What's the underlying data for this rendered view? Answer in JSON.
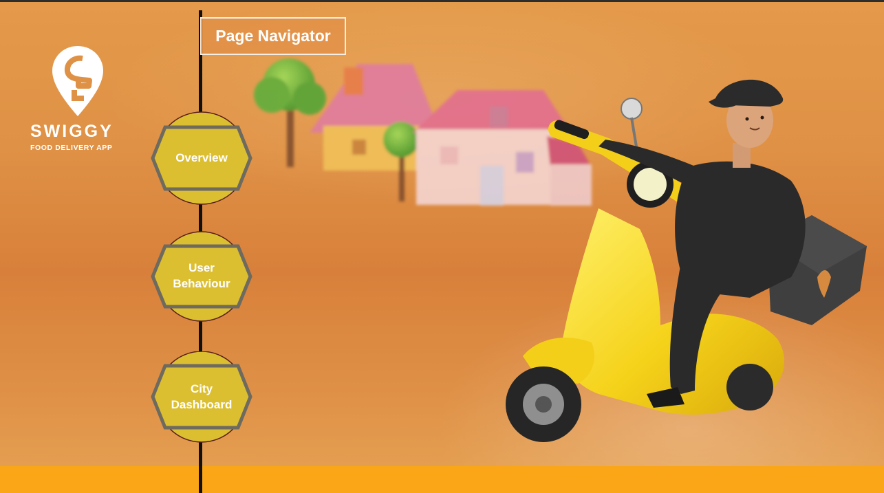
{
  "brand": {
    "name": "SWIGGY",
    "tagline": "FOOD DELIVERY APP",
    "logo_icon": "swiggy-pin-icon",
    "accent_color": "#fba617"
  },
  "navigator": {
    "title": "Page Navigator",
    "items": [
      {
        "label_lines": [
          "Overview"
        ]
      },
      {
        "label_lines": [
          "User",
          "Behaviour"
        ]
      },
      {
        "label_lines": [
          "City",
          "Dashboard"
        ]
      }
    ],
    "node_fill_color": "#dcbf31",
    "node_border_color": "#6f6a5e"
  },
  "background": {
    "scene": "delivery-rider-on-yellow-scooter",
    "base_color": "#df9145"
  }
}
